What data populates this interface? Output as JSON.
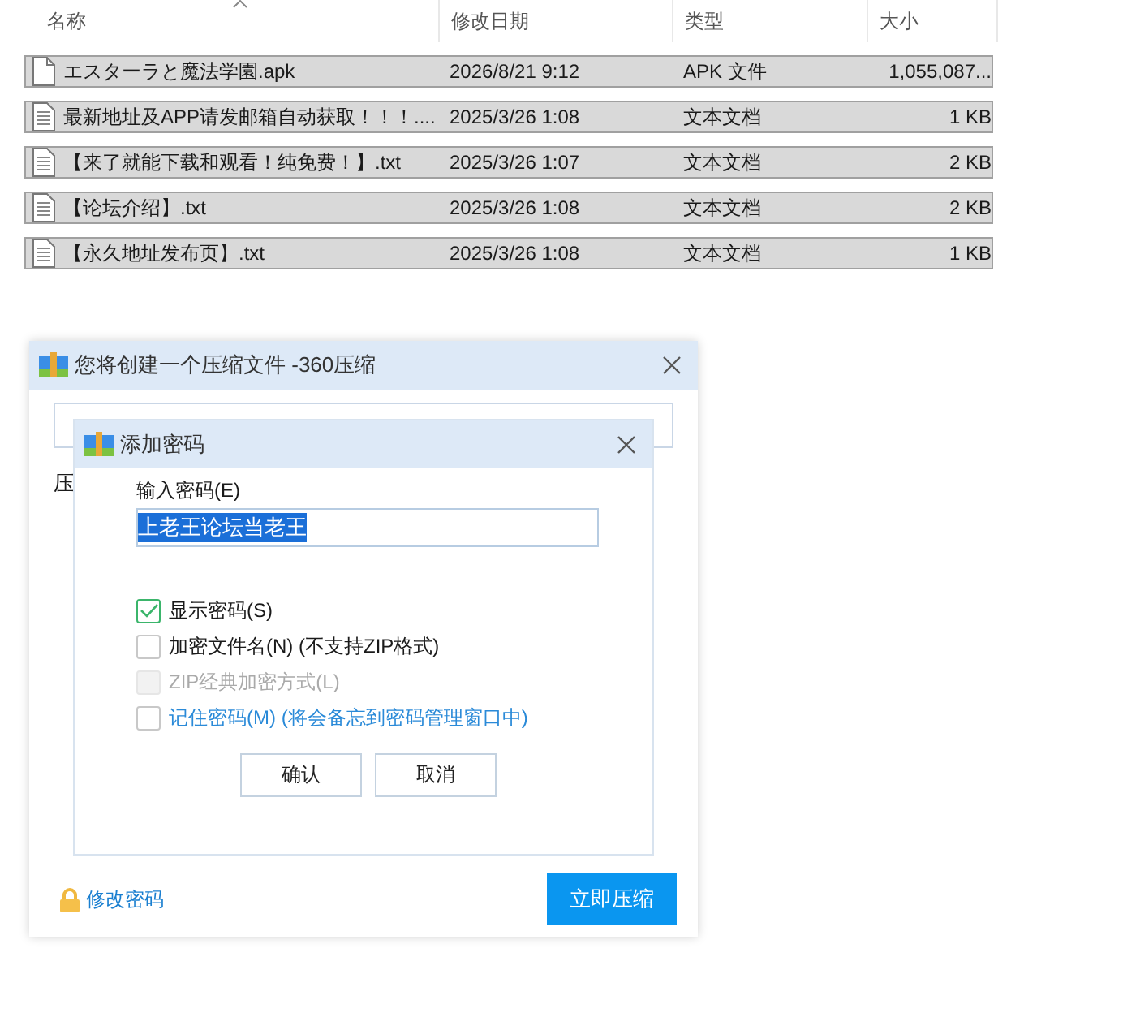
{
  "file_list": {
    "columns": [
      {
        "label": "名称",
        "sorted": true
      },
      {
        "label": "修改日期",
        "sorted": false
      },
      {
        "label": "类型",
        "sorted": false
      },
      {
        "label": "大小",
        "sorted": false
      }
    ],
    "rows": [
      {
        "kind": "blank",
        "name": "エスターラと魔法学園.apk",
        "date": "2026/8/21 9:12",
        "type": "APK 文件",
        "size": "1,055,087...",
        "selected": true
      },
      {
        "kind": "text",
        "name": "最新地址及APP请发邮箱自动获取！！！....",
        "date": "2025/3/26 1:08",
        "type": "文本文档",
        "size": "1 KB",
        "selected": true
      },
      {
        "kind": "text",
        "name": "【来了就能下载和观看！纯免费！】.txt",
        "date": "2025/3/26 1:07",
        "type": "文本文档",
        "size": "2 KB",
        "selected": true
      },
      {
        "kind": "text",
        "name": "【论坛介绍】.txt",
        "date": "2025/3/26 1:08",
        "type": "文本文档",
        "size": "2 KB",
        "selected": true
      },
      {
        "kind": "text",
        "name": "【永久地址发布页】.txt",
        "date": "2025/3/26 1:08",
        "type": "文本文档",
        "size": "1 KB",
        "selected": true
      }
    ]
  },
  "compress_dialog": {
    "title": "您将创建一个压缩文件 -360压缩",
    "label": "压",
    "change_password_link": "修改密码",
    "compress_button": "立即压缩"
  },
  "password_dialog": {
    "title": "添加密码",
    "password_label": "输入密码(E)",
    "password": "上老王论坛当老王",
    "password_text_selected": true,
    "options": [
      {
        "kind": "plain",
        "label": "显示密码(S)",
        "checked": true,
        "disabled": false
      },
      {
        "kind": "plain",
        "label": "加密文件名(N) (不支持ZIP格式)",
        "checked": false,
        "disabled": false
      },
      {
        "kind": "plain",
        "label": "ZIP经典加密方式(L)",
        "checked": false,
        "disabled": true
      },
      {
        "kind": "link",
        "label": "记住密码(M) (将会备忘到密码管理窗口中)",
        "checked": false,
        "disabled": false
      }
    ],
    "buttons": [
      "确认",
      "取消"
    ]
  }
}
